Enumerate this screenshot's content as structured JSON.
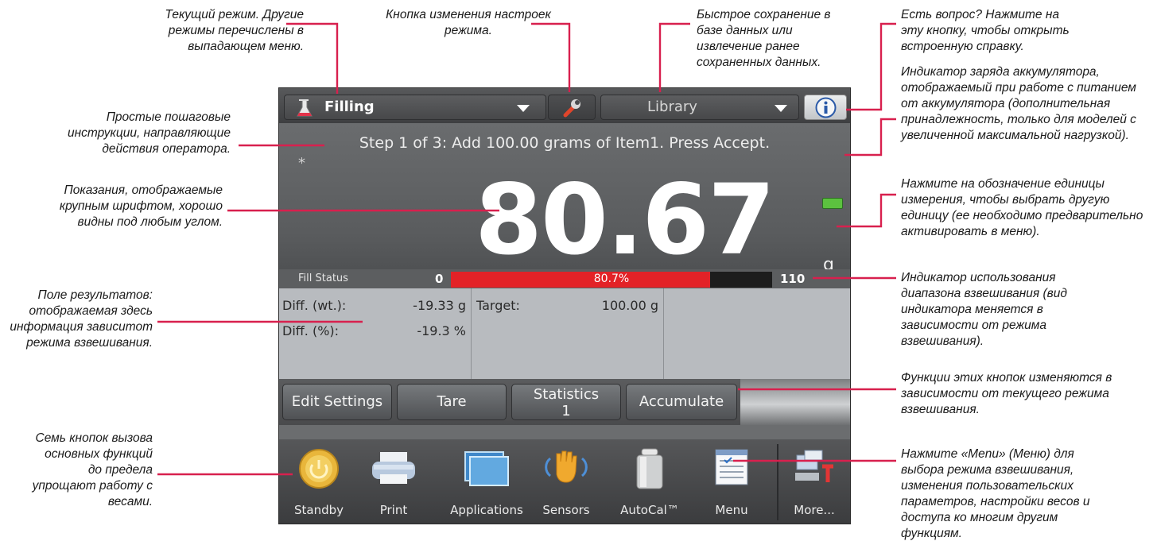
{
  "annotations": {
    "current_mode": "Текущий режим. Другие режимы перечислены в выпадающем меню.",
    "mode_settings": "Кнопка изменения настроек режима.",
    "library": "Быстрое сохранение в базе данных или извлечение ранее сохраненных данных.",
    "help": "Есть вопрос? Нажмите на эту кнопку, чтобы открыть встроенную справку.",
    "battery": "Индикатор заряда аккумулятора, отображаемый при работе с питанием от аккумулятора (дополнительная принадлежность, только для моделей с увеличенной максимальной нагрузкой).",
    "instructions": "Простые пошаговые инструкции, направляющие действия оператора.",
    "reading": "Показания, отображаемые крупным шрифтом, хорошо видны под любым углом.",
    "unit": "Нажмите на обозначение единицы измерения, чтобы выбрать другую единицу (ее необходимо предварительно активировать в меню).",
    "results": "Поле результатов: отображаемая здесь информация зависитот режима взвешивания.",
    "range_indicator": "Индикатор использования диапазона взвешивания (вид индикатора меняется в зависимости от режима взвешивания).",
    "function_buttons": "Функции этих кнопок изменяются в зависимости от текущего режима взвешивания.",
    "main_buttons": "Семь кнопок вызова основных функций до предела упрощают работу с весами.",
    "menu": "Нажмите «Menu» (Меню) для выбора режима взвешивания, изменения пользовательских параметров, настройки весов и доступа ко многим другим функциям."
  },
  "topbar": {
    "mode": "Filling",
    "library": "Library"
  },
  "display": {
    "step": "Step 1 of 3: Add 100.00 grams of Item1.  Press Accept.",
    "asterisk": "*",
    "reading": "80.67",
    "unit": "g"
  },
  "fill_status": {
    "label": "Fill Status",
    "min": "0",
    "max": "110",
    "percent_label": "80.7%",
    "fraction": 0.807
  },
  "results": {
    "diff_wt_label": "Diff. (wt.):",
    "diff_wt_value": "-19.33 g",
    "diff_pct_label": "Diff. (%):",
    "diff_pct_value": "-19.3 %",
    "target_label": "Target:",
    "target_value": "100.00 g"
  },
  "function_buttons": {
    "edit_settings": "Edit Settings",
    "tare": "Tare",
    "statistics": "Statistics",
    "statistics_count": "1",
    "accumulate": "Accumulate"
  },
  "nav": {
    "standby": "Standby",
    "print": "Print",
    "applications": "Applications",
    "sensors": "Sensors",
    "autocal": "AutoCal™",
    "menu": "Menu",
    "more": "More..."
  },
  "colors": {
    "accent_line": "#d8204e",
    "fill_bar": "#e32227",
    "battery": "#5cc23f"
  }
}
